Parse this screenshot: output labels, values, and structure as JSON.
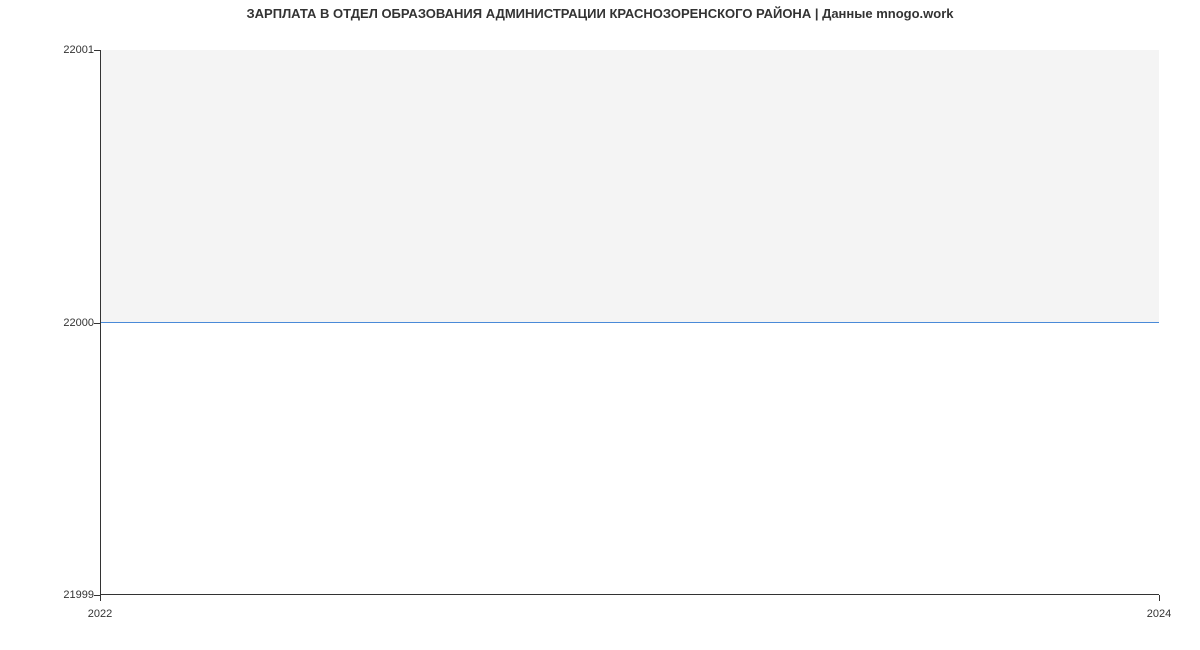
{
  "chart_data": {
    "type": "line",
    "title": "ЗАРПЛАТА В ОТДЕЛ ОБРАЗОВАНИЯ АДМИНИСТРАЦИИ КРАСНОЗОРЕНСКОГО РАЙОНА | Данные mnogo.work",
    "x": [
      2022,
      2024
    ],
    "values": [
      22000,
      22000
    ],
    "xlabel": "",
    "ylabel": "",
    "x_ticks": [
      "2022",
      "2024"
    ],
    "y_ticks": [
      "21999",
      "22000",
      "22001"
    ],
    "xlim": [
      2022,
      2024
    ],
    "ylim": [
      21999,
      22001
    ]
  }
}
